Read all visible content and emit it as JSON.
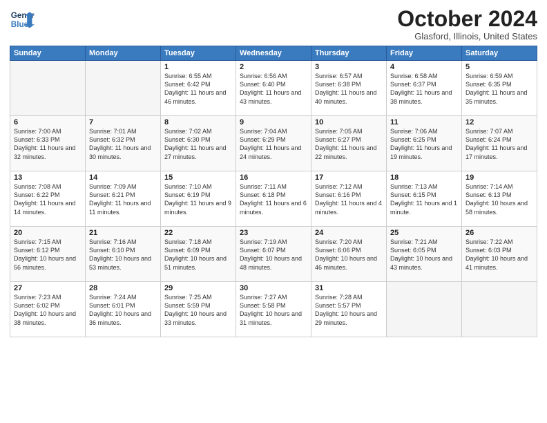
{
  "header": {
    "logo_line1": "General",
    "logo_line2": "Blue",
    "title": "October 2024",
    "location": "Glasford, Illinois, United States"
  },
  "days_of_week": [
    "Sunday",
    "Monday",
    "Tuesday",
    "Wednesday",
    "Thursday",
    "Friday",
    "Saturday"
  ],
  "weeks": [
    [
      {
        "day": "",
        "detail": ""
      },
      {
        "day": "",
        "detail": ""
      },
      {
        "day": "1",
        "detail": "Sunrise: 6:55 AM\nSunset: 6:42 PM\nDaylight: 11 hours and 46 minutes."
      },
      {
        "day": "2",
        "detail": "Sunrise: 6:56 AM\nSunset: 6:40 PM\nDaylight: 11 hours and 43 minutes."
      },
      {
        "day": "3",
        "detail": "Sunrise: 6:57 AM\nSunset: 6:38 PM\nDaylight: 11 hours and 40 minutes."
      },
      {
        "day": "4",
        "detail": "Sunrise: 6:58 AM\nSunset: 6:37 PM\nDaylight: 11 hours and 38 minutes."
      },
      {
        "day": "5",
        "detail": "Sunrise: 6:59 AM\nSunset: 6:35 PM\nDaylight: 11 hours and 35 minutes."
      }
    ],
    [
      {
        "day": "6",
        "detail": "Sunrise: 7:00 AM\nSunset: 6:33 PM\nDaylight: 11 hours and 32 minutes."
      },
      {
        "day": "7",
        "detail": "Sunrise: 7:01 AM\nSunset: 6:32 PM\nDaylight: 11 hours and 30 minutes."
      },
      {
        "day": "8",
        "detail": "Sunrise: 7:02 AM\nSunset: 6:30 PM\nDaylight: 11 hours and 27 minutes."
      },
      {
        "day": "9",
        "detail": "Sunrise: 7:04 AM\nSunset: 6:29 PM\nDaylight: 11 hours and 24 minutes."
      },
      {
        "day": "10",
        "detail": "Sunrise: 7:05 AM\nSunset: 6:27 PM\nDaylight: 11 hours and 22 minutes."
      },
      {
        "day": "11",
        "detail": "Sunrise: 7:06 AM\nSunset: 6:25 PM\nDaylight: 11 hours and 19 minutes."
      },
      {
        "day": "12",
        "detail": "Sunrise: 7:07 AM\nSunset: 6:24 PM\nDaylight: 11 hours and 17 minutes."
      }
    ],
    [
      {
        "day": "13",
        "detail": "Sunrise: 7:08 AM\nSunset: 6:22 PM\nDaylight: 11 hours and 14 minutes."
      },
      {
        "day": "14",
        "detail": "Sunrise: 7:09 AM\nSunset: 6:21 PM\nDaylight: 11 hours and 11 minutes."
      },
      {
        "day": "15",
        "detail": "Sunrise: 7:10 AM\nSunset: 6:19 PM\nDaylight: 11 hours and 9 minutes."
      },
      {
        "day": "16",
        "detail": "Sunrise: 7:11 AM\nSunset: 6:18 PM\nDaylight: 11 hours and 6 minutes."
      },
      {
        "day": "17",
        "detail": "Sunrise: 7:12 AM\nSunset: 6:16 PM\nDaylight: 11 hours and 4 minutes."
      },
      {
        "day": "18",
        "detail": "Sunrise: 7:13 AM\nSunset: 6:15 PM\nDaylight: 11 hours and 1 minute."
      },
      {
        "day": "19",
        "detail": "Sunrise: 7:14 AM\nSunset: 6:13 PM\nDaylight: 10 hours and 58 minutes."
      }
    ],
    [
      {
        "day": "20",
        "detail": "Sunrise: 7:15 AM\nSunset: 6:12 PM\nDaylight: 10 hours and 56 minutes."
      },
      {
        "day": "21",
        "detail": "Sunrise: 7:16 AM\nSunset: 6:10 PM\nDaylight: 10 hours and 53 minutes."
      },
      {
        "day": "22",
        "detail": "Sunrise: 7:18 AM\nSunset: 6:09 PM\nDaylight: 10 hours and 51 minutes."
      },
      {
        "day": "23",
        "detail": "Sunrise: 7:19 AM\nSunset: 6:07 PM\nDaylight: 10 hours and 48 minutes."
      },
      {
        "day": "24",
        "detail": "Sunrise: 7:20 AM\nSunset: 6:06 PM\nDaylight: 10 hours and 46 minutes."
      },
      {
        "day": "25",
        "detail": "Sunrise: 7:21 AM\nSunset: 6:05 PM\nDaylight: 10 hours and 43 minutes."
      },
      {
        "day": "26",
        "detail": "Sunrise: 7:22 AM\nSunset: 6:03 PM\nDaylight: 10 hours and 41 minutes."
      }
    ],
    [
      {
        "day": "27",
        "detail": "Sunrise: 7:23 AM\nSunset: 6:02 PM\nDaylight: 10 hours and 38 minutes."
      },
      {
        "day": "28",
        "detail": "Sunrise: 7:24 AM\nSunset: 6:01 PM\nDaylight: 10 hours and 36 minutes."
      },
      {
        "day": "29",
        "detail": "Sunrise: 7:25 AM\nSunset: 5:59 PM\nDaylight: 10 hours and 33 minutes."
      },
      {
        "day": "30",
        "detail": "Sunrise: 7:27 AM\nSunset: 5:58 PM\nDaylight: 10 hours and 31 minutes."
      },
      {
        "day": "31",
        "detail": "Sunrise: 7:28 AM\nSunset: 5:57 PM\nDaylight: 10 hours and 29 minutes."
      },
      {
        "day": "",
        "detail": ""
      },
      {
        "day": "",
        "detail": ""
      }
    ]
  ]
}
